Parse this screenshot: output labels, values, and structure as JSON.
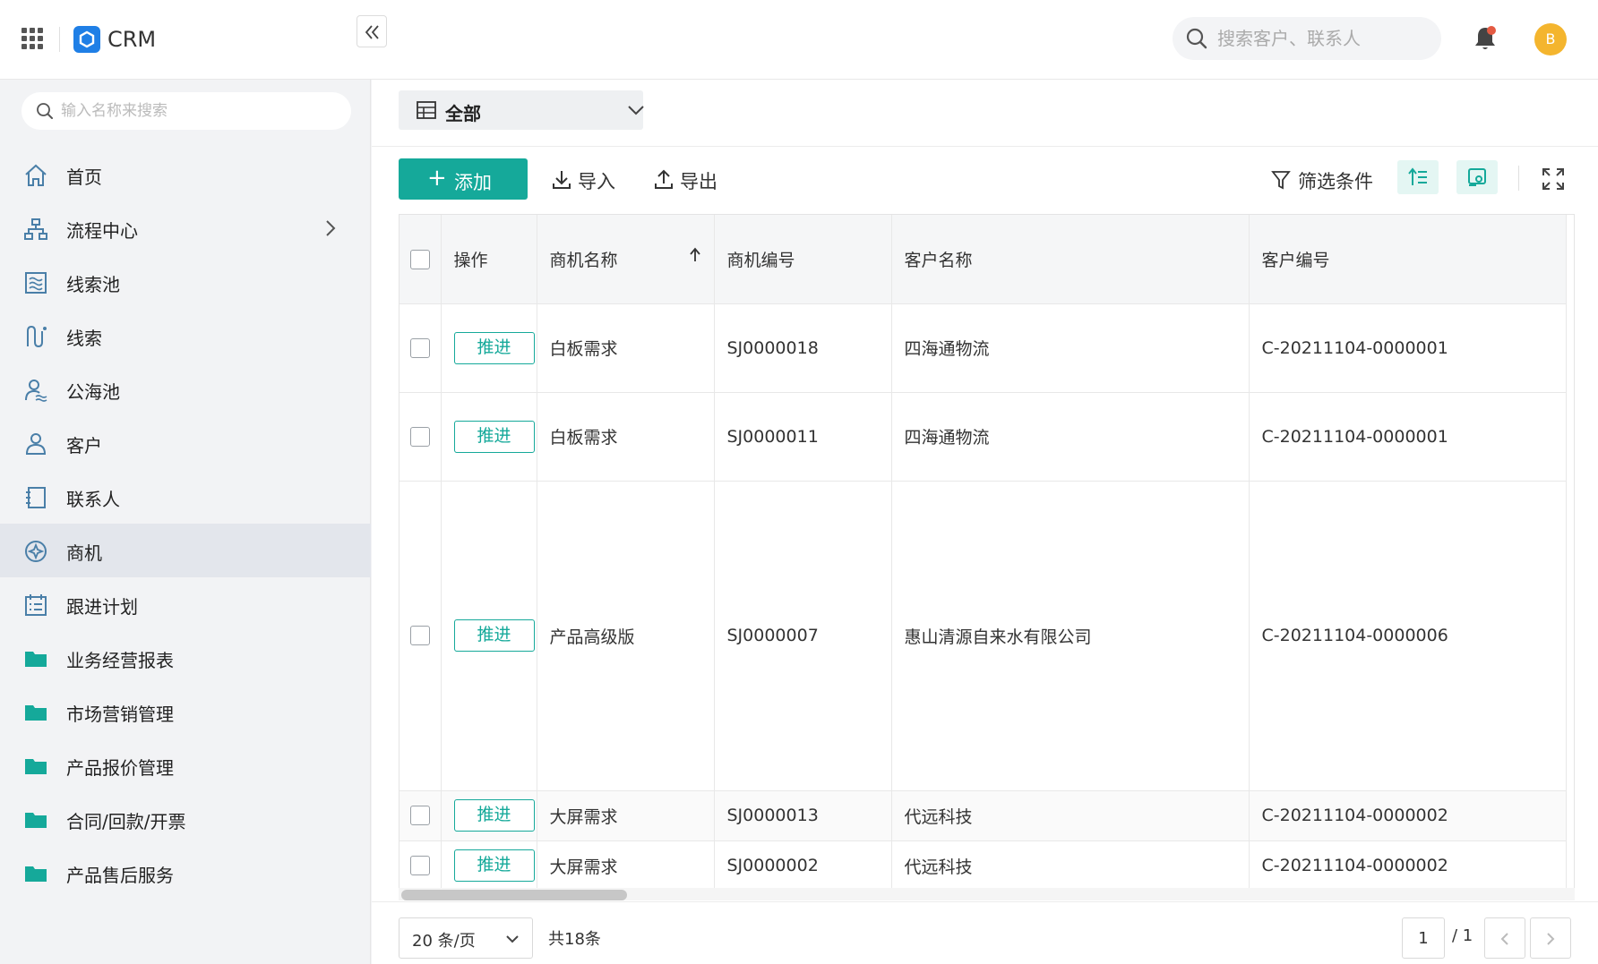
{
  "header": {
    "brand": "CRM",
    "search_placeholder": "搜索客户、联系人",
    "avatar_initial": "B",
    "accent": "#15a99a",
    "brand_color": "#1f7fe6"
  },
  "sidebar": {
    "search_placeholder": "输入名称来搜索",
    "items": [
      {
        "label": "首页",
        "icon": "home-icon"
      },
      {
        "label": "流程中心",
        "icon": "org-chart-icon"
      },
      {
        "label": "线索池",
        "icon": "leads-pool-icon"
      },
      {
        "label": "线索",
        "icon": "route-icon"
      },
      {
        "label": "公海池",
        "icon": "public-pool-icon"
      },
      {
        "label": "客户",
        "icon": "customer-icon"
      },
      {
        "label": "联系人",
        "icon": "contacts-icon"
      },
      {
        "label": "商机",
        "icon": "opportunity-icon"
      },
      {
        "label": "跟进计划",
        "icon": "calendar-icon"
      },
      {
        "label": "业务经营报表",
        "icon": "folder-icon"
      },
      {
        "label": "市场营销管理",
        "icon": "folder-icon"
      },
      {
        "label": "产品报价管理",
        "icon": "folder-icon"
      },
      {
        "label": "合同/回款/开票",
        "icon": "folder-icon"
      },
      {
        "label": "产品售后服务",
        "icon": "folder-icon"
      }
    ]
  },
  "main": {
    "view_label": "全部",
    "toolbar": {
      "add": "添加",
      "import": "导入",
      "export": "导出",
      "filter": "筛选条件"
    },
    "table": {
      "columns": [
        "操作",
        "商机名称",
        "商机编号",
        "客户名称",
        "客户编号"
      ],
      "action_label": "推进",
      "rows": [
        {
          "name": "白板需求",
          "code": "SJ0000018",
          "customer": "四海通物流",
          "customer_code": "C-20211104-0000001"
        },
        {
          "name": "白板需求",
          "code": "SJ0000011",
          "customer": "四海通物流",
          "customer_code": "C-20211104-0000001"
        },
        {
          "name": "产品高级版",
          "code": "SJ0000007",
          "customer": "惠山清源自来水有限公司",
          "customer_code": "C-20211104-0000006"
        },
        {
          "name": "大屏需求",
          "code": "SJ0000013",
          "customer": "代远科技",
          "customer_code": "C-20211104-0000002"
        },
        {
          "name": "大屏需求",
          "code": "SJ0000002",
          "customer": "代远科技",
          "customer_code": "C-20211104-0000002"
        }
      ]
    },
    "pagination": {
      "page_size": "20 条/页",
      "total": "共18条",
      "current_page": "1",
      "total_pages": "/ 1"
    }
  }
}
